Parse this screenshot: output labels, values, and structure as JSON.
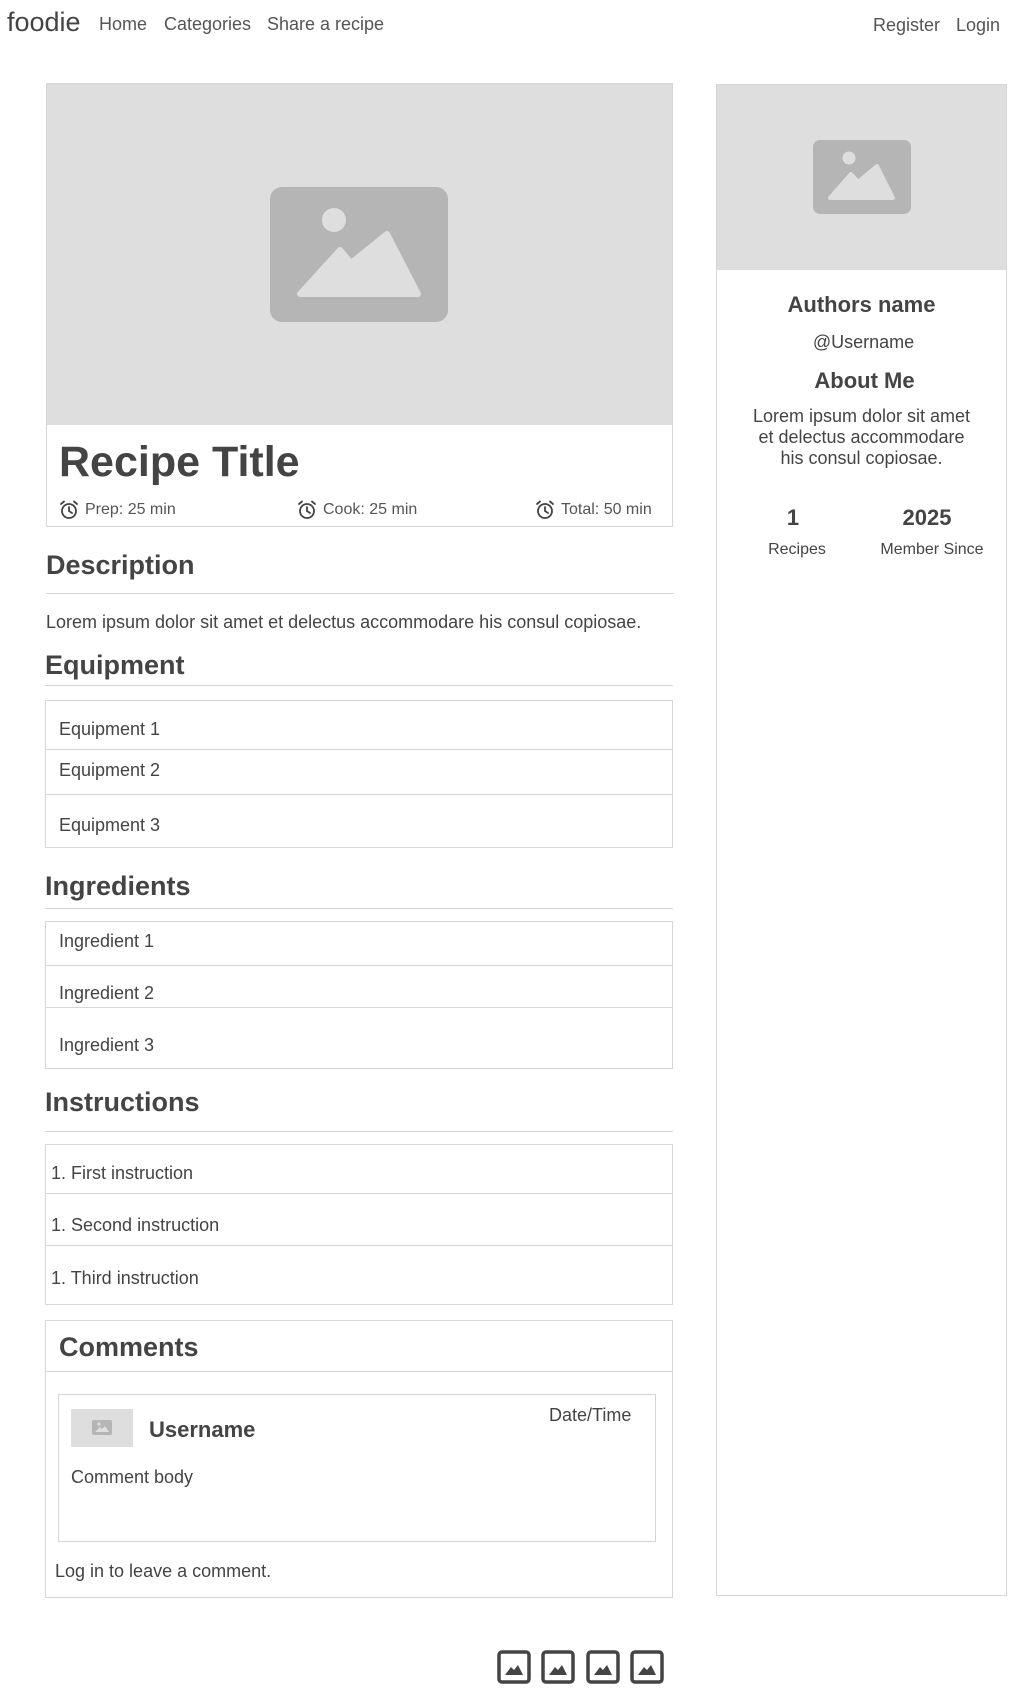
{
  "navbar": {
    "brand": "foodie",
    "links": [
      "Home",
      "Categories",
      "Share a recipe"
    ],
    "right_links": [
      "Register",
      "Login"
    ]
  },
  "hero": {
    "image_icon": "image-placeholder-icon",
    "title": "Recipe Title",
    "times": {
      "prep": "Prep: 25 min",
      "cook": "Cook: 25 min",
      "total": "Total: 50 min"
    },
    "time_icon": "alarm-clock-icon"
  },
  "description": {
    "heading": "Description",
    "text": "Lorem ipsum dolor sit amet et delectus accommodare his consul copiosae."
  },
  "equipment": {
    "heading": "Equipment",
    "items": [
      "Equipment 1",
      "Equipment 2",
      "Equipment 3"
    ]
  },
  "ingredients": {
    "heading": "Ingredients",
    "items": [
      "Ingredient 1",
      "Ingredient 2",
      "Ingredient 3"
    ]
  },
  "instructions": {
    "heading": "Instructions",
    "items": [
      "1. First instruction",
      "1. Second instruction",
      "1. Third instruction"
    ]
  },
  "comments": {
    "heading": "Comments",
    "comment": {
      "username": "Username",
      "datetime": "Date/Time",
      "body": "Comment body",
      "avatar_icon": "image-placeholder-icon"
    },
    "login_prompt": "Log in to leave a comment."
  },
  "author": {
    "image_icon": "image-placeholder-icon",
    "name": "Authors name",
    "username": "@Username",
    "about_heading": "About Me",
    "about_text_lines": [
      "Lorem ipsum dolor sit amet",
      "et delectus accommodare",
      "his consul copiosae."
    ],
    "stats": [
      {
        "value": "1",
        "label": "Recipes"
      },
      {
        "value": "2025",
        "label": "Member Since"
      }
    ]
  },
  "footer": {
    "icons": [
      "image-icon",
      "image-icon",
      "image-icon",
      "image-icon"
    ]
  },
  "colors": {
    "text": "#444444",
    "placeholder_bg": "#dedede",
    "placeholder_icon": "#b5b5b5",
    "border": "#d6d6d6"
  }
}
